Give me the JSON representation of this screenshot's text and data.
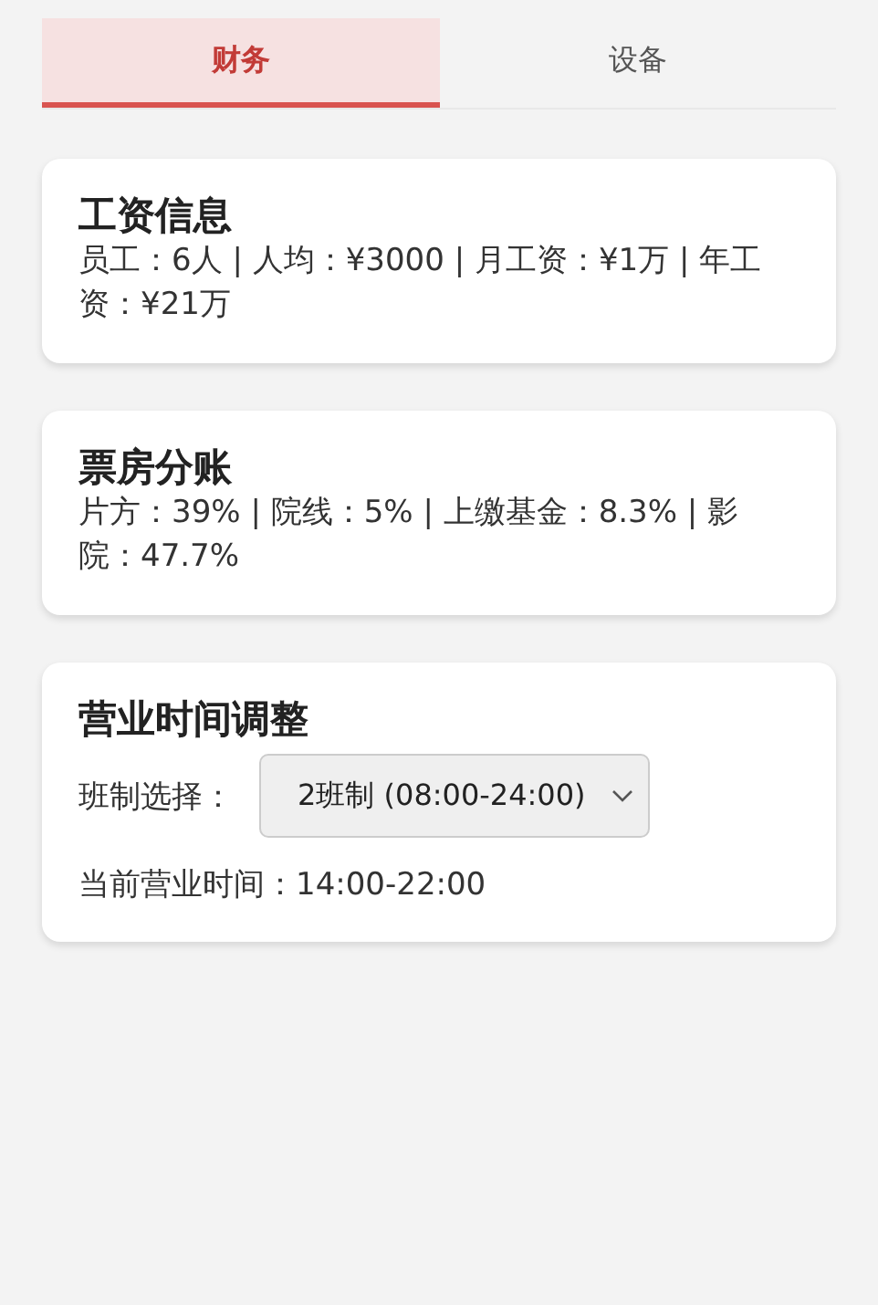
{
  "tabs": [
    {
      "label": "财务",
      "selected": true
    },
    {
      "label": "设备",
      "selected": false
    }
  ],
  "cards": [
    {
      "kind": "info",
      "title": "工资信息",
      "text": "员工：6人 | 人均：¥3000 | 月工资：¥1万 | 年工资：¥21万"
    },
    {
      "kind": "info",
      "title": "票房分账",
      "text": "片方：39% | 院线：5% | 上缴基金：8.3% | 影院：47.7%"
    },
    {
      "kind": "hours",
      "title": "营业时间调整",
      "select_label": "班制选择：",
      "select_value": "2班制 (08:00-24:00)",
      "current": "当前营业时间：14:00-22:00"
    }
  ]
}
